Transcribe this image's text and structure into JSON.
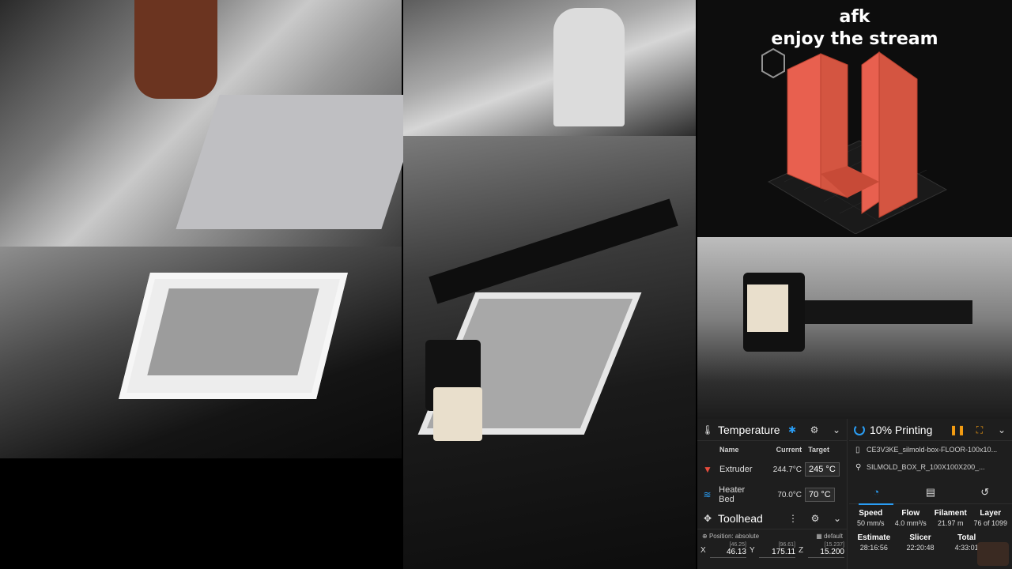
{
  "overlay": {
    "line1": "afk",
    "line2": "enjoy the stream"
  },
  "temperature": {
    "title": "Temperature",
    "headers": {
      "name": "Name",
      "current": "Current",
      "target": "Target"
    },
    "rows": [
      {
        "name": "Extruder",
        "current": "244.7°C",
        "target": "245",
        "unit": "°C",
        "icon": "extruder-icon",
        "color": "#e74c3c"
      },
      {
        "name": "Heater Bed",
        "current": "70.0°C",
        "target": "70",
        "unit": "°C",
        "icon": "heater-bed-icon",
        "color": "#2a9df4"
      }
    ]
  },
  "toolhead": {
    "title": "Toolhead",
    "position_label": "Position: absolute",
    "default_label": "default",
    "axes": [
      {
        "label": "X",
        "requested": "[46.25]",
        "current": "46.13"
      },
      {
        "label": "Y",
        "requested": "[96.61]",
        "current": "175.11"
      },
      {
        "label": "Z",
        "requested": "[15.237]",
        "current": "15.200"
      }
    ]
  },
  "print_status": {
    "title": "10% Printing",
    "files": [
      "CE3V3KE_silmold-box-FLOOR-100x10...",
      "SILMOLD_BOX_R_100X100X200_..."
    ],
    "stats": [
      {
        "label": "Speed",
        "value": "50 mm/s"
      },
      {
        "label": "Flow",
        "value": "4.0 mm³/s"
      },
      {
        "label": "Filament",
        "value": "21.97 m"
      },
      {
        "label": "Layer",
        "value": "76 of 1099"
      }
    ],
    "times": [
      {
        "label": "Estimate",
        "value": "28:16:56"
      },
      {
        "label": "Slicer",
        "value": "22:20:48"
      },
      {
        "label": "Total",
        "value": "4:33:01"
      }
    ]
  },
  "colors": {
    "accent": "#2a9df4",
    "warning": "#f39c12",
    "model": "#e8604f",
    "panel_bg": "#1e1e1e"
  }
}
